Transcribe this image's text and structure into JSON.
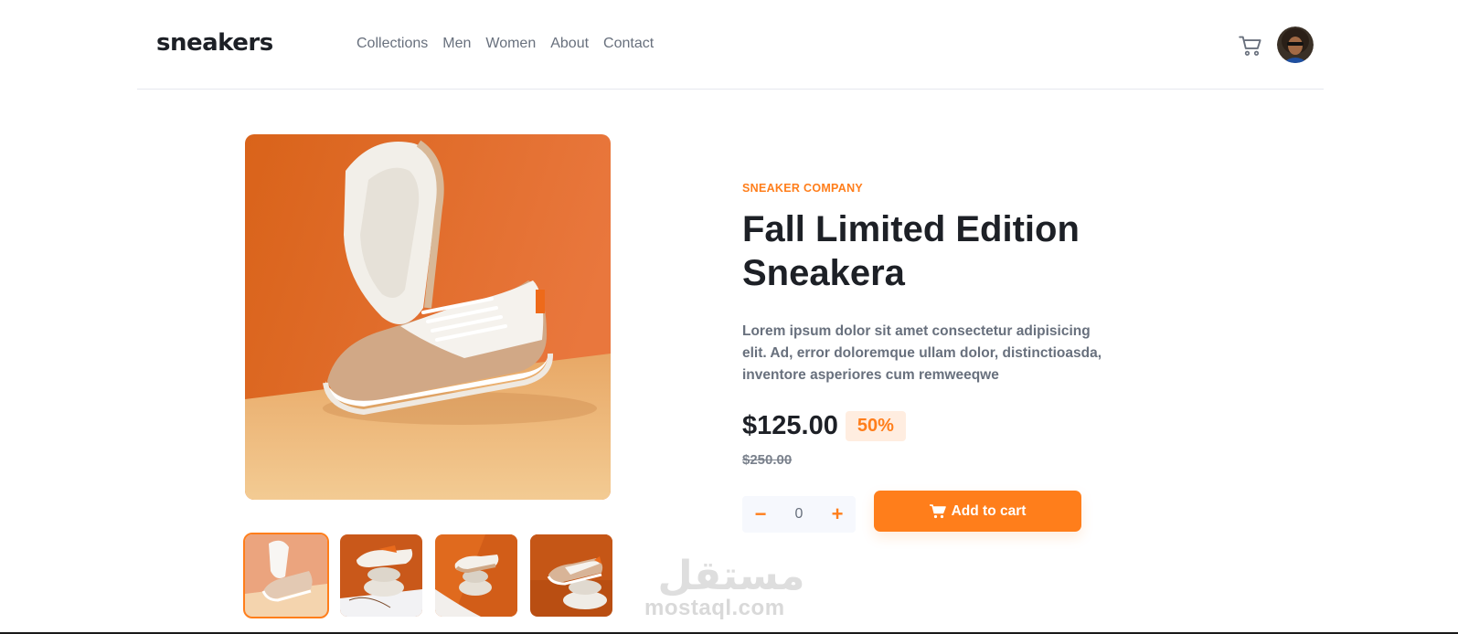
{
  "header": {
    "logo": "sneakers",
    "nav": [
      "Collections",
      "Men",
      "Women",
      "About",
      "Contact"
    ],
    "cart_icon": "cart-icon",
    "avatar_icon": "avatar"
  },
  "product": {
    "company": "SNEAKER COMPANY",
    "title": "Fall Limited Edition Sneakera",
    "description": "Lorem ipsum dolor sit amet consectetur adipisicing elit. Ad, error doloremque ullam dolor, distinctioasda, inventore asperiores cum remweeqwe",
    "price": "$125.00",
    "discount": "50%",
    "old_price": "$250.00",
    "quantity": "0",
    "minus_label": "−",
    "plus_label": "+",
    "add_to_cart": "Add to cart"
  },
  "gallery": {
    "active_index": 0,
    "thumbnail_count": 4
  },
  "watermark": {
    "arabic": "مستقل",
    "latin": "mostaql.com"
  },
  "colors": {
    "accent": "#ff7e1b",
    "accent_light": "#ffede0",
    "dark": "#1d2026",
    "muted": "#68707d"
  }
}
